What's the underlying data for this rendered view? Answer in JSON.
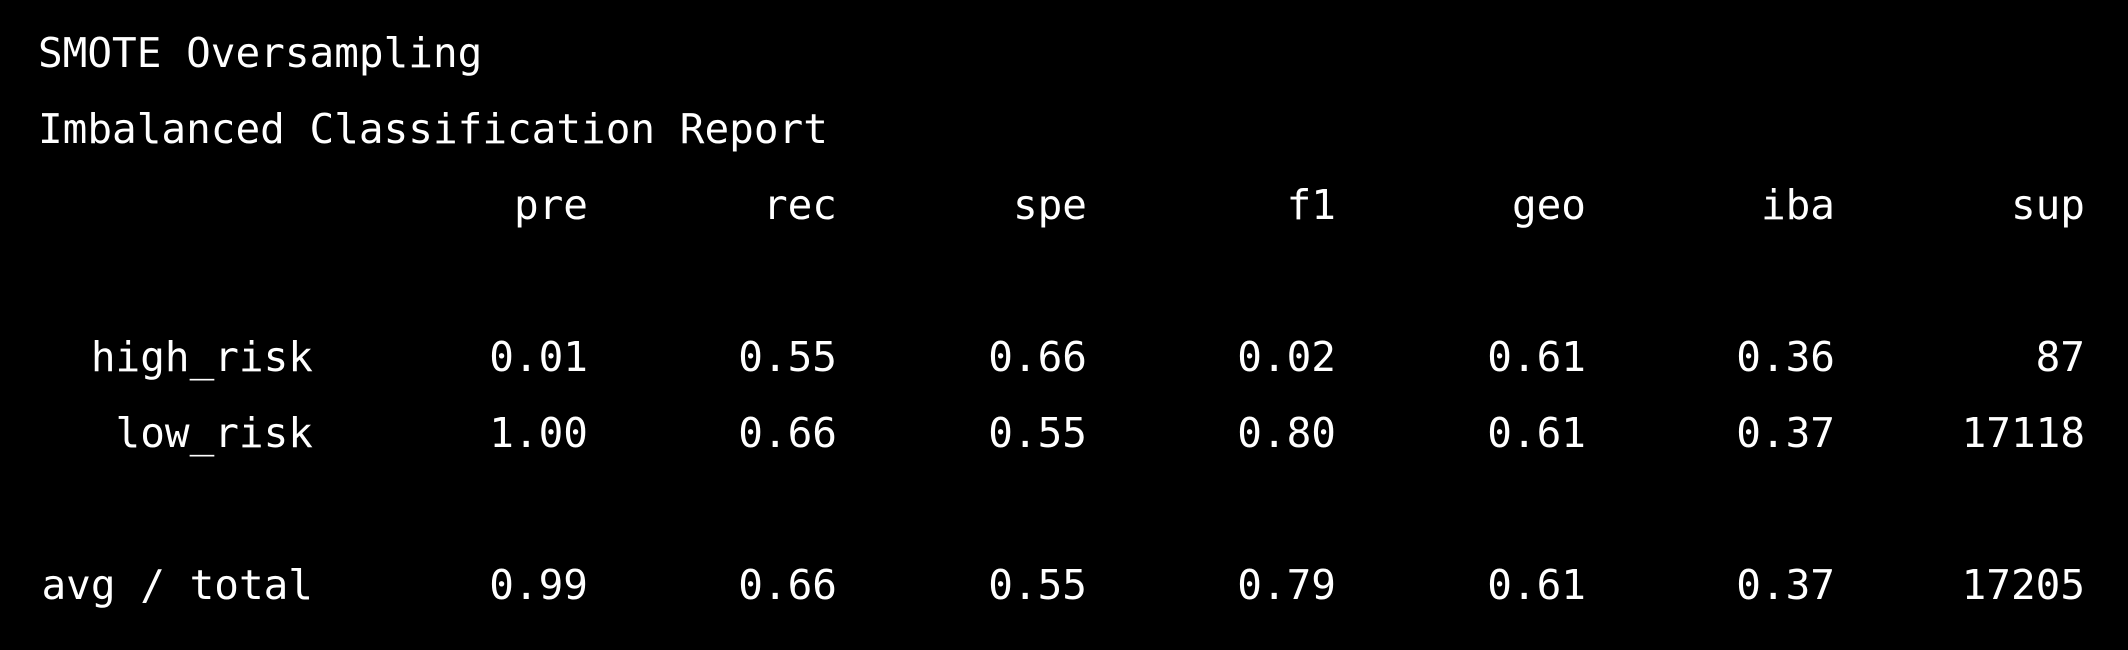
{
  "report": {
    "title": "SMOTE Oversampling",
    "subtitle": "Imbalanced Classification Report",
    "columns": [
      "pre",
      "rec",
      "spe",
      "f1",
      "geo",
      "iba",
      "sup"
    ],
    "rows": [
      {
        "label": "high_risk",
        "values": [
          "0.01",
          "0.55",
          "0.66",
          "0.02",
          "0.61",
          "0.36",
          "87"
        ]
      },
      {
        "label": "low_risk",
        "values": [
          "1.00",
          "0.66",
          "0.55",
          "0.80",
          "0.61",
          "0.37",
          "17118"
        ]
      }
    ],
    "total": {
      "label": "avg / total",
      "values": [
        "0.99",
        "0.66",
        "0.55",
        "0.79",
        "0.61",
        "0.37",
        "17205"
      ]
    }
  },
  "colors": {
    "background": "#000000",
    "text": "#ffffff"
  }
}
